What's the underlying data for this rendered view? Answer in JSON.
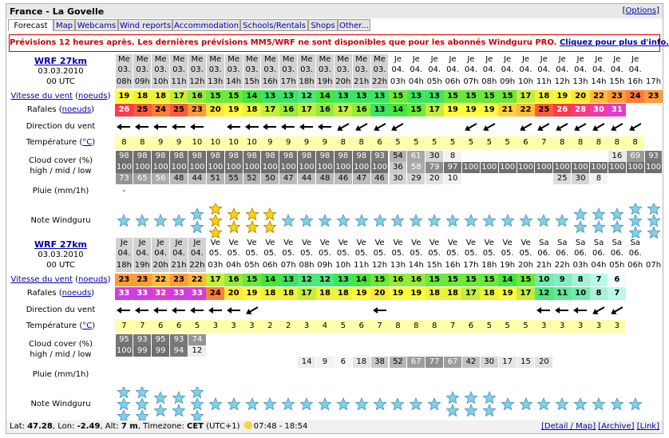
{
  "page": {
    "title": "France - La Govelle",
    "options": "Options"
  },
  "tabs": [
    "Forecast",
    "Map",
    "Webcams",
    "Wind reports",
    "Accommodation",
    "Schools/Rentals",
    "Shops",
    "Other..."
  ],
  "notice": {
    "text": "Prévisions 12 heures après. Les dernières prévisions MM5/WRF ne sont disponibles que pour les abonnés Windguru PRO.",
    "link": "Cliquez pour plus d'info."
  },
  "labels": {
    "wind_prefix": "Vitesse du vent",
    "wind_unit": "noeuds",
    "gust_prefix": "Rafales",
    "gust_unit": "noeuds",
    "direction": "Direction du vent",
    "temp_prefix": "Température",
    "temp_unit": "°C",
    "cloud1": "Cloud cover (%)",
    "cloud2": "high / mid / low",
    "rain": "Pluie (mm/1h)",
    "rating": "Note Windguru"
  },
  "colors": {
    "day_shade": "#d2d2d2",
    "wind_scale": {
      "5": "#ffffff",
      "6": "#f0ffff",
      "7": "#b8f8e8",
      "8": "#a8f0d8",
      "9": "#86ecc4",
      "10": "#74eaac",
      "11": "#62e896",
      "12": "#4ee67e",
      "13": "#3ee462",
      "14": "#46e63c",
      "15": "#6ee83a",
      "16": "#96ea3a",
      "17": "#c4ee3a",
      "18": "#eef23a",
      "19": "#fffa3a",
      "20": "#ffe83a",
      "21": "#ffd23a",
      "22": "#ffbc3a",
      "23": "#ff9c3a",
      "24": "#ff7c3a",
      "25": "#ff5a3a",
      "26": "#ff3a4a",
      "28": "#ff3a7a",
      "30": "#f23aa8",
      "31": "#e23ad2",
      "33": "#d23ae6"
    },
    "temp_bg": "#ffffaa",
    "star": "#7fd0e8",
    "star_gold": "#ffd200"
  },
  "panels": [
    {
      "model": "WRF 27km",
      "date": "03.03.2010",
      "utc": "00 UTC",
      "days": [
        "Me",
        "Me",
        "Me",
        "Me",
        "Me",
        "Me",
        "Me",
        "Me",
        "Me",
        "Me",
        "Me",
        "Me",
        "Me",
        "Me",
        "Me",
        "Je",
        "Je",
        "Je",
        "Je",
        "Je",
        "Je",
        "Je",
        "Je",
        "Je",
        "Je",
        "Je",
        "Je",
        "Je",
        "Je"
      ],
      "dates": [
        "03.",
        "03.",
        "03.",
        "03.",
        "03.",
        "03.",
        "03.",
        "03.",
        "03.",
        "03.",
        "03.",
        "03.",
        "03.",
        "03.",
        "03.",
        "04.",
        "04.",
        "04.",
        "04.",
        "04.",
        "04.",
        "04.",
        "04.",
        "04.",
        "04.",
        "04.",
        "04.",
        "04.",
        "04."
      ],
      "hours": [
        "08h",
        "09h",
        "10h",
        "11h",
        "12h",
        "13h",
        "14h",
        "15h",
        "16h",
        "17h",
        "18h",
        "19h",
        "20h",
        "21h",
        "22h",
        "03h",
        "04h",
        "05h",
        "06h",
        "07h",
        "08h",
        "09h",
        "10h",
        "11h",
        "12h",
        "13h",
        "14h",
        "15h",
        "16h",
        "17h"
      ],
      "wind": [
        19,
        18,
        18,
        17,
        16,
        15,
        15,
        14,
        13,
        13,
        12,
        14,
        13,
        13,
        13,
        15,
        13,
        13,
        15,
        15,
        15,
        15,
        17,
        18,
        19,
        20,
        22,
        23,
        24,
        23
      ],
      "gusts": [
        26,
        25,
        24,
        25,
        23,
        20,
        19,
        18,
        17,
        16,
        17,
        16,
        17,
        16,
        13,
        14,
        15,
        17,
        19,
        19,
        19,
        21,
        22,
        25,
        26,
        28,
        30,
        31
      ],
      "direction": [
        "w",
        "w",
        "w",
        "w",
        "w",
        "",
        "w",
        "w",
        "w",
        "w",
        "w",
        "w",
        "sw",
        "sw",
        "sw",
        "sw",
        "",
        "",
        "",
        "sw",
        "sw",
        "",
        "sw",
        "sw",
        "sw",
        "sw",
        "sw",
        "sw",
        "sw"
      ],
      "temp": [
        8,
        8,
        9,
        9,
        10,
        10,
        10,
        10,
        9,
        9,
        9,
        9,
        8,
        8,
        6,
        5,
        5,
        5,
        5,
        5,
        5,
        5,
        6,
        7,
        8,
        8,
        8,
        8,
        8
      ],
      "cloud_high": [
        "98",
        "98",
        "98",
        "98",
        "98",
        "98",
        "98",
        "98",
        "98",
        "98",
        "98",
        "98",
        "98",
        "98",
        "93",
        "54",
        "61",
        "30",
        "8",
        "",
        "",
        "",
        "",
        "",
        "",
        "",
        "",
        "16",
        "69",
        "93"
      ],
      "cloud_mid": [
        "100",
        "100",
        "100",
        "100",
        "100",
        "100",
        "100",
        "100",
        "100",
        "100",
        "100",
        "100",
        "100",
        "100",
        "100",
        "36",
        "58",
        "79",
        "97",
        "100",
        "100",
        "100",
        "100",
        "100",
        "100",
        "100",
        "100",
        "100",
        "100",
        "100"
      ],
      "cloud_low": [
        "73",
        "65",
        "56",
        "48",
        "44",
        "51",
        "55",
        "52",
        "50",
        "47",
        "44",
        "48",
        "46",
        "47",
        "46",
        "30",
        "29",
        "20",
        "10",
        "",
        "",
        "",
        "",
        "",
        "25",
        "30",
        "8",
        "",
        ""
      ],
      "rain": [
        "-",
        "",
        "",
        "",
        "",
        "",
        "",
        "",
        "",
        "",
        "",
        "",
        "",
        "",
        "",
        "",
        "",
        "",
        "",
        "",
        "",
        "",
        "",
        "",
        "",
        "",
        "",
        "",
        "",
        ""
      ],
      "rating": [
        1,
        1,
        1,
        1,
        2,
        3,
        2,
        2,
        2,
        1,
        1,
        1,
        1,
        1,
        1,
        1,
        1,
        1,
        1,
        1,
        1,
        1,
        1,
        1,
        1,
        2,
        2,
        2,
        3,
        3,
        3,
        3,
        3,
        3
      ]
    },
    {
      "model": "WRF 27km",
      "date": "03.03.2010",
      "utc": "00 UTC",
      "days": [
        "Je",
        "Je",
        "Je",
        "Je",
        "Je",
        "Ve",
        "Ve",
        "Ve",
        "Ve",
        "Ve",
        "Ve",
        "Ve",
        "Ve",
        "Ve",
        "Ve",
        "Ve",
        "Ve",
        "Ve",
        "Ve",
        "Ve",
        "Ve",
        "Ve",
        "Ve",
        "Sa",
        "Sa",
        "Sa",
        "Sa",
        "Sa",
        "Sa"
      ],
      "dates": [
        "04.",
        "04.",
        "04.",
        "04.",
        "04.",
        "05.",
        "05.",
        "05.",
        "05.",
        "05.",
        "05.",
        "05.",
        "05.",
        "05.",
        "05.",
        "05.",
        "05.",
        "05.",
        "05.",
        "05.",
        "05.",
        "05.",
        "05.",
        "06.",
        "06.",
        "06.",
        "06.",
        "06.",
        "06."
      ],
      "hours": [
        "18h",
        "19h",
        "20h",
        "21h",
        "22h",
        "03h",
        "04h",
        "05h",
        "06h",
        "07h",
        "08h",
        "09h",
        "10h",
        "11h",
        "12h",
        "13h",
        "14h",
        "15h",
        "16h",
        "17h",
        "18h",
        "19h",
        "20h",
        "21h",
        "22h",
        "03h",
        "04h",
        "05h",
        "06h",
        "07h"
      ],
      "wind": [
        23,
        23,
        22,
        23,
        22,
        17,
        16,
        15,
        14,
        13,
        12,
        12,
        13,
        14,
        15,
        16,
        16,
        15,
        15,
        15,
        15,
        14,
        15,
        10,
        9,
        8,
        7,
        6
      ],
      "gusts": [
        33,
        33,
        32,
        33,
        33,
        24,
        20,
        19,
        18,
        18,
        17,
        18,
        18,
        19,
        20,
        19,
        19,
        18,
        18,
        17,
        18,
        19,
        17,
        12,
        11,
        10,
        8,
        7
      ],
      "direction": [
        "w",
        "w",
        "w",
        "w",
        "w",
        "w",
        "w",
        "sw",
        "",
        "",
        "",
        "",
        "",
        "",
        "w",
        "",
        "",
        "",
        "",
        "",
        "",
        "",
        "",
        "w",
        "w",
        "w",
        "sw",
        "sw"
      ],
      "temp": [
        7,
        7,
        6,
        6,
        5,
        3,
        3,
        3,
        2,
        2,
        3,
        4,
        5,
        6,
        7,
        8,
        8,
        8,
        7,
        6,
        5,
        5,
        5,
        3,
        3,
        3,
        3,
        3
      ],
      "cloud_high": [
        "95",
        "93",
        "95",
        "93",
        "74",
        "",
        "",
        "",
        "",
        "",
        "",
        "",
        "",
        "",
        "",
        "",
        "",
        "",
        "",
        "",
        "",
        "",
        "",
        "",
        "",
        "",
        "",
        "",
        ""
      ],
      "cloud_mid": [
        "100",
        "99",
        "99",
        "94",
        "12",
        "",
        "",
        "",
        "",
        "",
        "",
        "",
        "",
        "",
        "",
        "",
        "",
        "",
        "",
        "",
        "",
        "",
        "",
        "",
        "",
        "",
        "",
        "",
        ""
      ],
      "cloud_low": [
        "",
        "",
        "",
        "",
        "",
        "",
        "",
        "",
        "",
        "",
        "14",
        "9",
        "6",
        "18",
        "38",
        "52",
        "67",
        "77",
        "67",
        "42",
        "30",
        "17",
        "15",
        "20",
        "",
        "",
        "",
        "",
        ""
      ],
      "rain": [
        "",
        "",
        "",
        "",
        "",
        "",
        "",
        "",
        "",
        "",
        "",
        "",
        "",
        "",
        "",
        "",
        "",
        "",
        "",
        "",
        "",
        "",
        "",
        "",
        "",
        "",
        "",
        "",
        ""
      ],
      "rating": [
        3,
        3,
        2,
        2,
        3,
        1,
        1,
        1,
        1,
        1,
        1,
        1,
        1,
        1,
        1,
        1,
        1,
        1,
        2,
        2,
        2,
        1,
        1,
        1,
        1,
        1,
        1,
        1,
        1
      ]
    }
  ],
  "footer": {
    "lat_label": "Lat:",
    "lat": "47.28",
    "lon_label": "Lon:",
    "lon": "-2.49",
    "alt_label": "Alt:",
    "alt": "7 m",
    "tz_label": "Timezone:",
    "tz": "CET",
    "tz_offset": "(UTC+1)",
    "sun": "07:48 - 18:54",
    "links": [
      "[Detail / Map]",
      "[Archive]",
      "[Link]"
    ]
  }
}
